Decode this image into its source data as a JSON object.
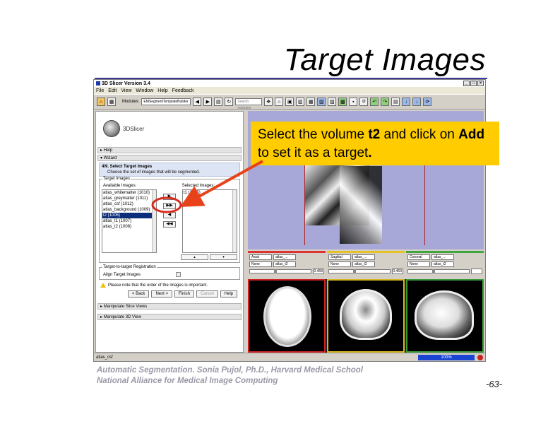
{
  "slide": {
    "title": "Target Images",
    "footer_line1": "Automatic Segmentation. Sonia Pujol, Ph.D., Harvard Medical School",
    "footer_line2": "National Alliance for Medical Image Computing",
    "page_number": "-63-"
  },
  "callout": {
    "part1": "Select the volume ",
    "bold1": "t2",
    "part2": " and click on ",
    "bold2": "Add",
    "part3": " to set it as a target",
    "bold3": "."
  },
  "window": {
    "title": "3D Slicer Version 3.4",
    "menu": [
      "File",
      "Edit",
      "View",
      "Window",
      "Help",
      "Feedback"
    ],
    "toolbar": {
      "modules_label": "Modules:",
      "module_selected": "EMSegmentTemplateBuilder",
      "search_placeholder": "Search modules"
    }
  },
  "left_panel": {
    "logo_text": "3DSlicer",
    "help_label": "Help",
    "wizard_label": "Wizard",
    "step_title": "4/9. Select Target Images",
    "step_desc": "Choose the set of images that will be segmented.",
    "target_images_legend": "Target Images",
    "available_label": "Available Images:",
    "selected_label": "Selected Images:",
    "available_items": [
      "atlas_whitematter (1010)",
      "atlas_greymatter (1011)",
      "atlas_csf (1012)",
      "atlas_background (1009)",
      "t2 (1006)",
      "atlas_t1 (1007)",
      "atlas_t2 (1008)"
    ],
    "selected_index": 4,
    "selected_items": [
      "t1 (1005)"
    ],
    "arrows": [
      "▶",
      "▶▶",
      "◀",
      "◀◀"
    ],
    "registration_legend": "Target-to-target Registration",
    "align_label": "Align Target Images",
    "note": "Please note that the order of the images is important.",
    "buttons": [
      "< Back",
      "Next >",
      "Finish",
      "Cancel",
      "Help"
    ],
    "manipulate_slice": "Manipulate Slice Views",
    "manipulate_3d": "Manipulate 3D View"
  },
  "slice_controls": [
    {
      "orientation": "Axial",
      "label_vol": "atlas_...",
      "fg": "None",
      "bg": "atlas_t2",
      "value": "0.468"
    },
    {
      "orientation": "Sagittal",
      "label_vol": "atlas_...",
      "fg": "None",
      "bg": "atlas_t2",
      "value": "0.469"
    },
    {
      "orientation": "Coronal",
      "label_vol": "atlas_...",
      "fg": "None",
      "bg": "atlas_t2",
      "value": ""
    }
  ],
  "status": {
    "text": "atlas_csf",
    "progress": "100%"
  }
}
